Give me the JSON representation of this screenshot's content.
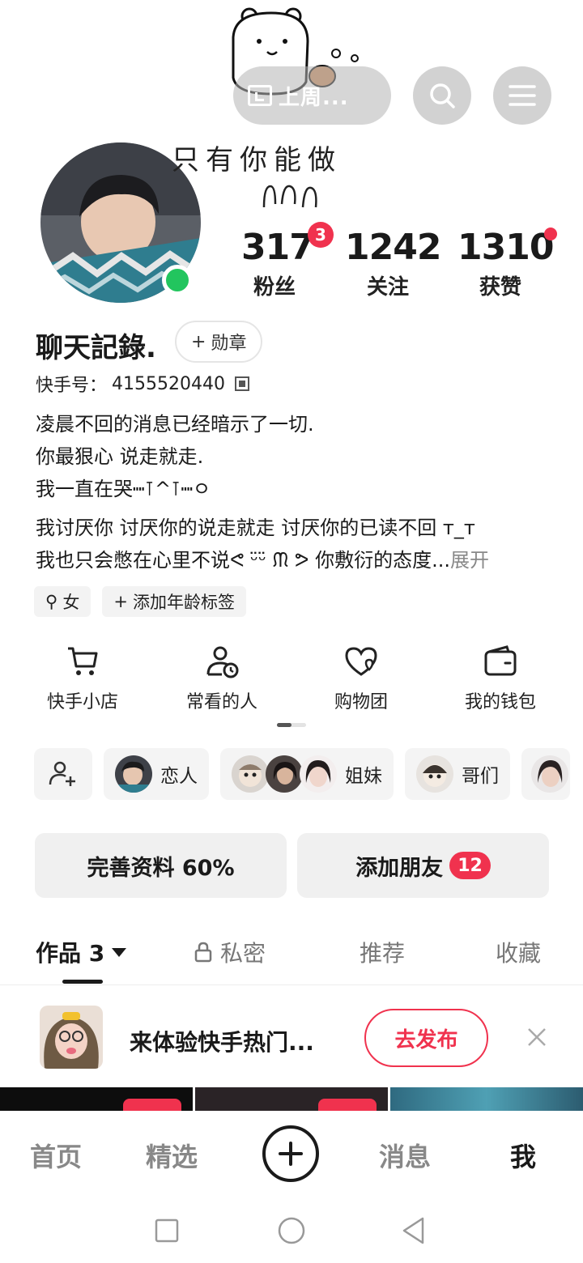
{
  "header": {
    "pill_label": "上周..."
  },
  "handwriting": "只有你能做",
  "stats": {
    "fans": {
      "value": "317",
      "label": "粉丝",
      "badge": "3"
    },
    "following": {
      "value": "1242",
      "label": "关注"
    },
    "likes": {
      "value": "1310",
      "label": "获赞"
    }
  },
  "profile": {
    "name": "聊天記錄.",
    "medal_label": "勋章",
    "id_label": "快手号：",
    "id_value": "4155520440"
  },
  "bio": {
    "line1": "凌晨不回的消息已经暗示了一切.",
    "line2": "你最狠心  说走就走.",
    "line3": "我一直在哭┉⊺^⊺┉ㅇ",
    "line4": "我讨厌你 讨厌你的说走就走 讨厌你的已读不回 ᴛ_ᴛ",
    "line5": "我也只会憋在心里不说ᕙ ᵕ̈ᵕ̈ ᙏ ᕗ 你敷衍的态度...",
    "expand": "展开"
  },
  "tags": {
    "gender": "女",
    "add_age": "添加年龄标签"
  },
  "actions": [
    {
      "label": "快手小店",
      "icon": "cart-icon"
    },
    {
      "label": "常看的人",
      "icon": "user-clock-icon"
    },
    {
      "label": "购物团",
      "icon": "heart-group-icon"
    },
    {
      "label": "我的钱包",
      "icon": "wallet-icon"
    }
  ],
  "groups": [
    {
      "label": "恋人"
    },
    {
      "label": "姐妹"
    },
    {
      "label": "哥们"
    }
  ],
  "buttons": {
    "profile_complete": "完善资料 60%",
    "add_friends": "添加朋友",
    "add_friends_count": "12"
  },
  "tabs": {
    "works": "作品 3",
    "private": "私密",
    "recommend": "推荐",
    "favorites": "收藏"
  },
  "promo": {
    "text": "来体验快手热门...",
    "publish": "去发布"
  },
  "nav": {
    "home": "首页",
    "featured": "精选",
    "messages": "消息",
    "me": "我"
  },
  "colors": {
    "accent": "#f0324e",
    "online": "#22c55e"
  }
}
